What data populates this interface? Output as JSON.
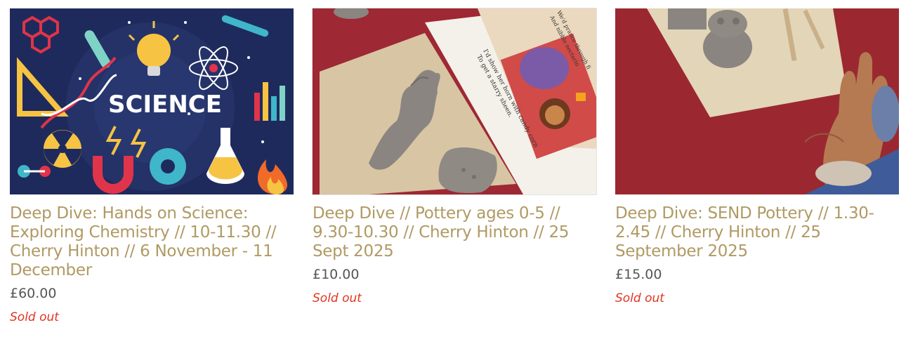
{
  "products": [
    {
      "image_alt": "SCIENCE",
      "title": "Deep Dive: Hands on Science: Exploring Chemistry // 10-11.30 // Cherry Hinton // 6 November - 11 December",
      "price": "£60.00",
      "status": "Sold out"
    },
    {
      "image_alt": "I'd show her horn with candy corn To get a starry sheen. We'd prance through fi And nibble nectarin",
      "title": "Deep Dive // Pottery ages 0-5 // 9.30-10.30 // Cherry Hinton // 25 Sept 2025",
      "price": "£10.00",
      "status": "Sold out"
    },
    {
      "image_alt": "",
      "title": "Deep Dive: SEND Pottery // 1.30-2.45 // Cherry Hinton // 25 September 2025",
      "price": "£15.00",
      "status": "Sold out"
    }
  ],
  "colors": {
    "title": "#b09a63",
    "price": "#555555",
    "sold_out": "#e0341f",
    "science_bg": "#1f2a5c",
    "tablecloth": "#a32a32",
    "clay": "#8a8580"
  },
  "science_image": {
    "word": "SCIENCE",
    "book_line_1": "I'd show her horn with candy corn",
    "book_line_2": "To get a starry sheen.",
    "book_line_3": "We'd prance through fi",
    "book_line_4": "And nibble nectarin"
  }
}
